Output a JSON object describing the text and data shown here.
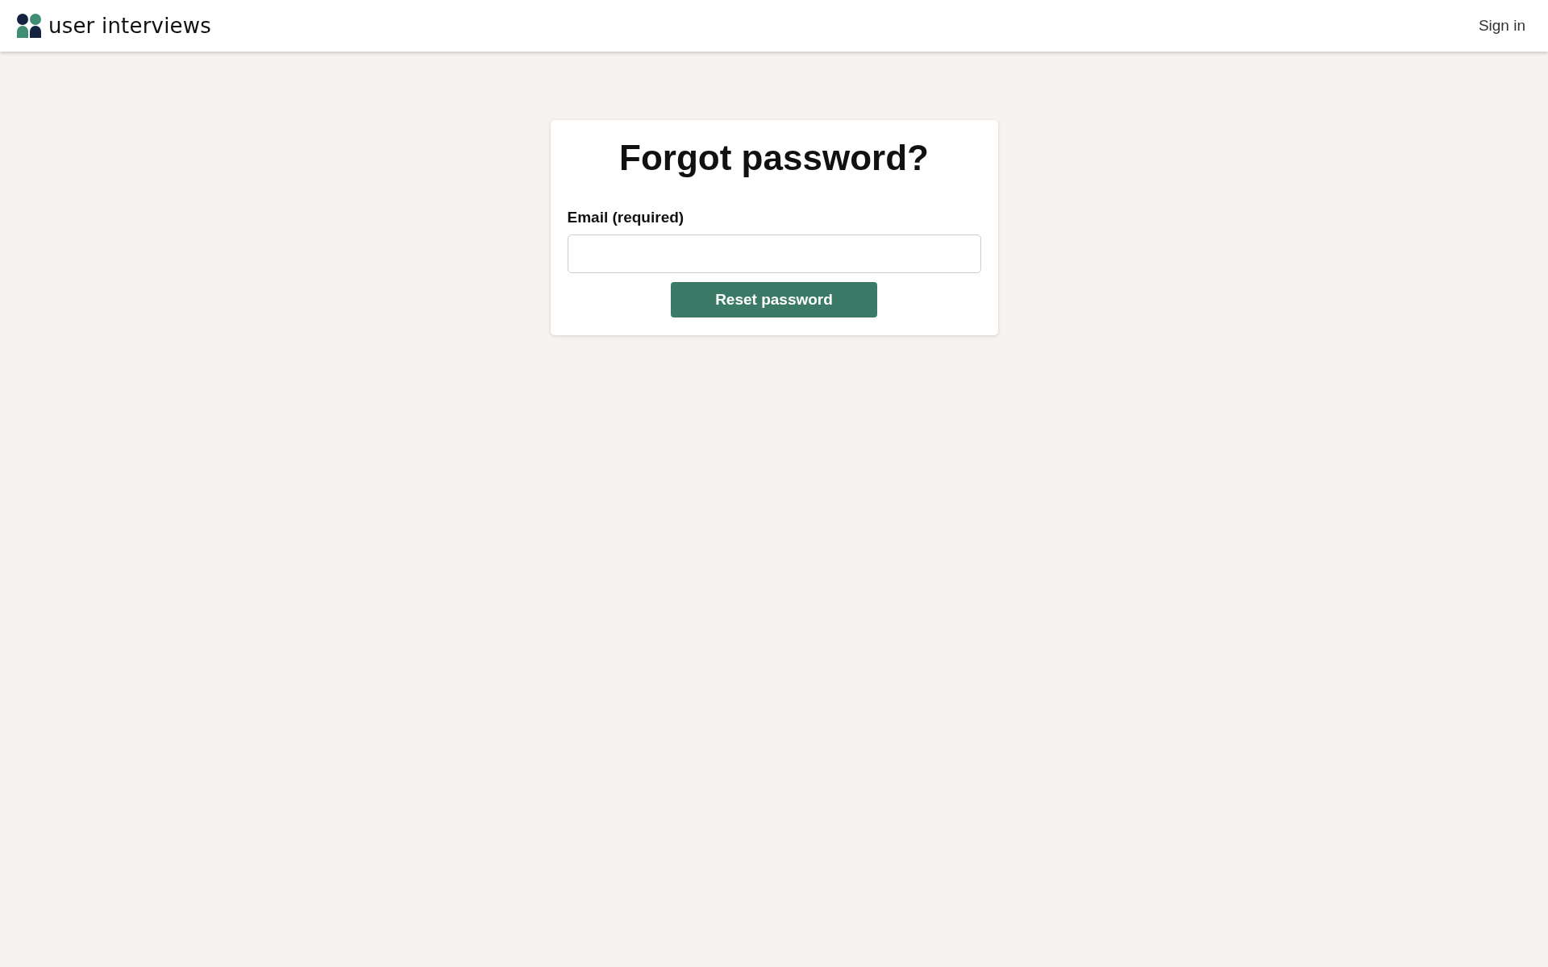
{
  "header": {
    "brand": "user interviews",
    "sign_in": "Sign in"
  },
  "form": {
    "title": "Forgot password?",
    "email_label": "Email (required)",
    "submit": "Reset password"
  }
}
